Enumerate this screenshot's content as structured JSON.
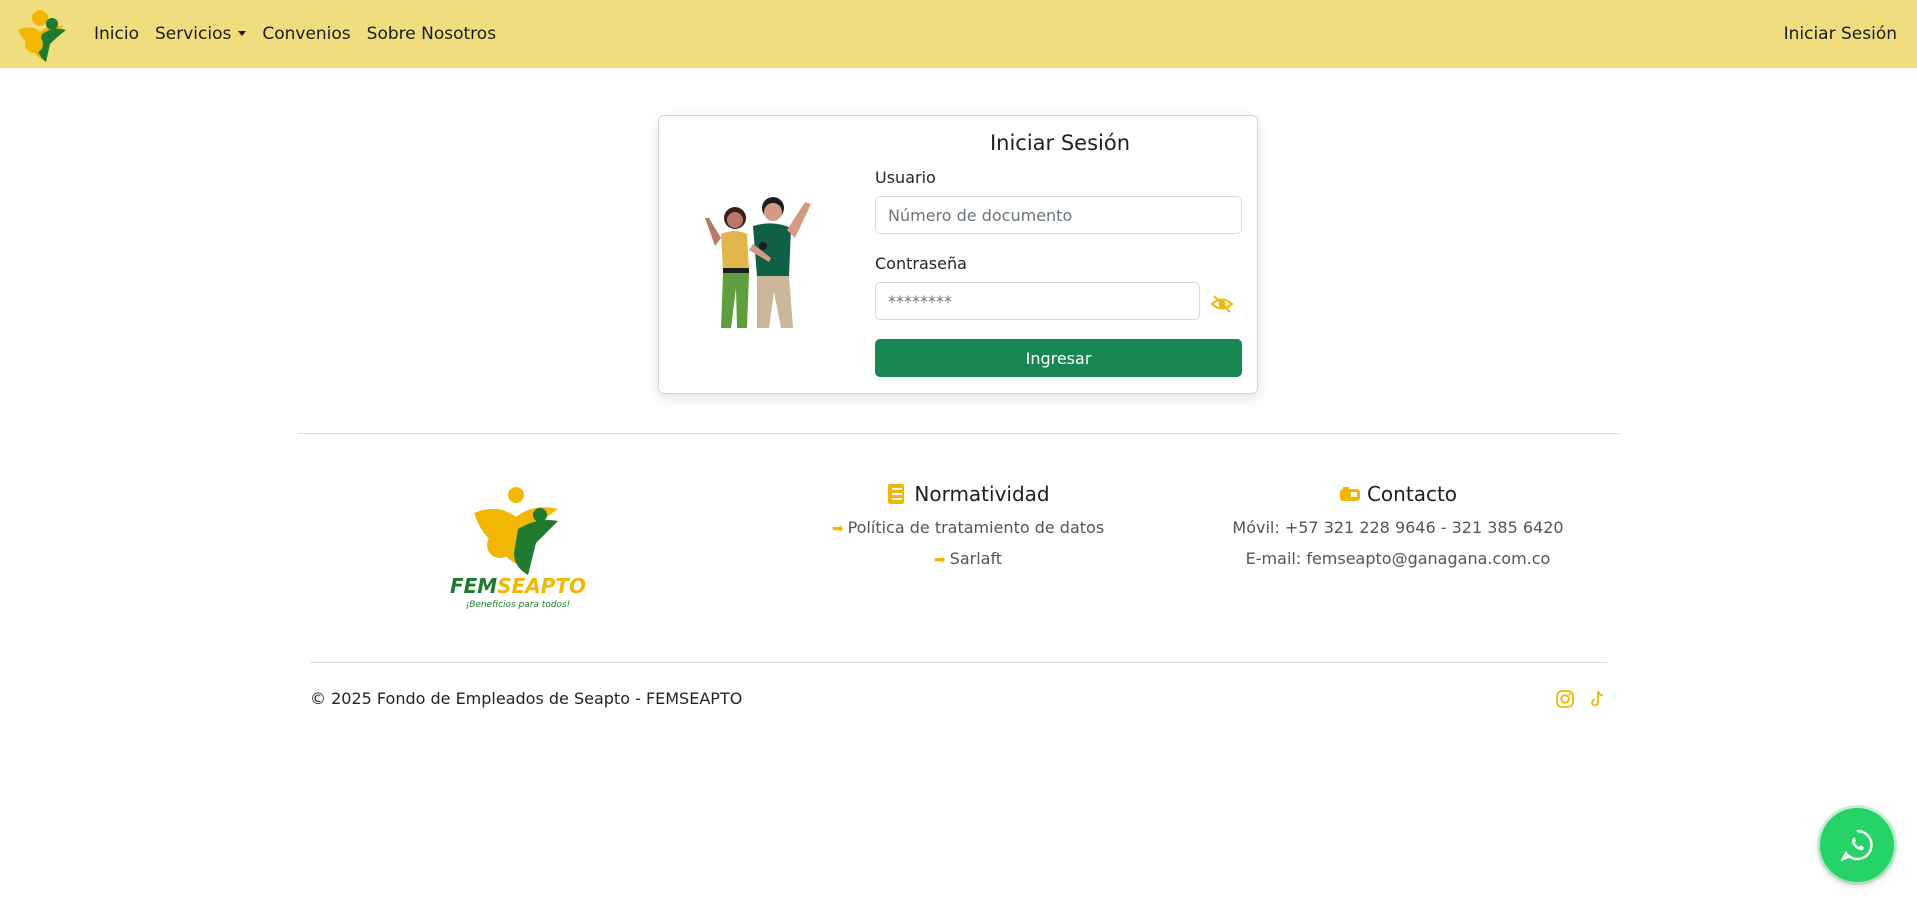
{
  "navbar": {
    "brand_icon": "femseapto-logo-icon",
    "links": [
      "Inicio",
      "Servicios",
      "Convenios",
      "Sobre Nosotros"
    ],
    "login": "Iniciar Sesión"
  },
  "login_card": {
    "title": "Iniciar Sesión",
    "user_label": "Usuario",
    "user_placeholder": "Número de documento",
    "user_value": "",
    "password_label": "Contraseña",
    "password_value": "********",
    "toggle_icon": "eye-slash-icon",
    "submit": "Ingresar"
  },
  "footer": {
    "logo_text": "FEMSEAPTO",
    "logo_tagline": "¡Beneficios para todos!",
    "normatividad": {
      "title": "Normatividad",
      "icon": "ruler-icon",
      "links": [
        "Política de tratamiento de datos",
        "Sarlaft"
      ]
    },
    "contacto": {
      "title": "Contacto",
      "icon": "mailbox-icon",
      "lines": [
        "Móvil: +57 321 228 9646 - 321 385 6420",
        "E-mail: femseapto@ganagana.com.co"
      ]
    },
    "copyright": "© 2025 Fondo de Empleados de Seapto - FEMSEAPTO",
    "social": [
      "instagram-icon",
      "tiktok-icon"
    ]
  },
  "whatsapp_icon": "whatsapp-icon",
  "colors": {
    "navbar_bg": "#f0dd7e",
    "primary_button": "#198754",
    "accent_yellow": "#f2b705",
    "brand_green": "#1f7a2e",
    "whatsapp_green": "#25d366"
  }
}
